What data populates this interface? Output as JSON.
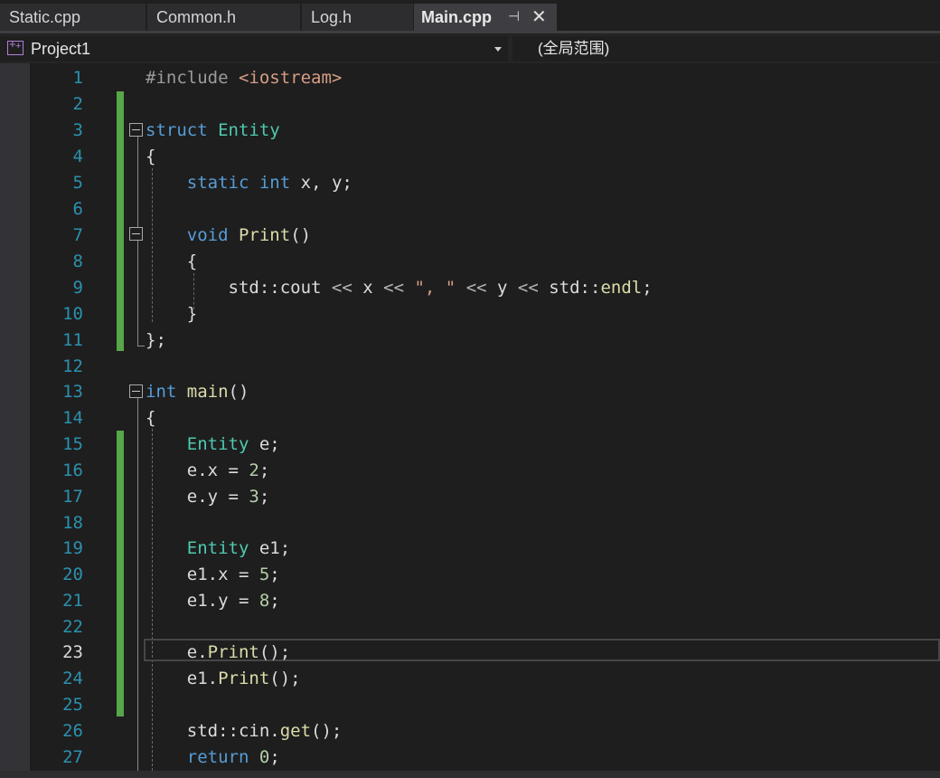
{
  "tabs": [
    {
      "label": "Static.cpp",
      "active": false
    },
    {
      "label": "Common.h",
      "active": false
    },
    {
      "label": "Log.h",
      "active": false
    },
    {
      "label": "Main.cpp",
      "active": true
    }
  ],
  "tab_icons": {
    "pin": "pin-icon",
    "close": "close-icon"
  },
  "nav": {
    "project": "Project1",
    "scope": "(全局范围)"
  },
  "editor": {
    "current_line": 23,
    "modified_line_ranges": [
      [
        2,
        11
      ],
      [
        15,
        25
      ]
    ],
    "lines": [
      {
        "n": "1",
        "code": "#include <iostream>"
      },
      {
        "n": "2",
        "code": ""
      },
      {
        "n": "3",
        "code": "struct Entity"
      },
      {
        "n": "4",
        "code": "{"
      },
      {
        "n": "5",
        "code": "    static int x, y;"
      },
      {
        "n": "6",
        "code": ""
      },
      {
        "n": "7",
        "code": "    void Print()"
      },
      {
        "n": "8",
        "code": "    {"
      },
      {
        "n": "9",
        "code": "        std::cout << x << \", \" << y << std::endl;"
      },
      {
        "n": "10",
        "code": "    }"
      },
      {
        "n": "11",
        "code": "};"
      },
      {
        "n": "12",
        "code": ""
      },
      {
        "n": "13",
        "code": "int main()"
      },
      {
        "n": "14",
        "code": "{"
      },
      {
        "n": "15",
        "code": "    Entity e;"
      },
      {
        "n": "16",
        "code": "    e.x = 2;"
      },
      {
        "n": "17",
        "code": "    e.y = 3;"
      },
      {
        "n": "18",
        "code": ""
      },
      {
        "n": "19",
        "code": "    Entity e1;"
      },
      {
        "n": "20",
        "code": "    e1.x = 5;"
      },
      {
        "n": "21",
        "code": "    e1.y = 8;"
      },
      {
        "n": "22",
        "code": ""
      },
      {
        "n": "23",
        "code": "    e.Print();"
      },
      {
        "n": "24",
        "code": "    e1.Print();"
      },
      {
        "n": "25",
        "code": ""
      },
      {
        "n": "26",
        "code": "    std::cin.get();"
      },
      {
        "n": "27",
        "code": "    return 0;"
      }
    ]
  },
  "colors": {
    "keyword": "#569cd6",
    "type": "#4ec9b0",
    "function": "#dcdcaa",
    "string": "#d69d85",
    "number": "#b5cea8",
    "preprocessor": "#9b9b9b",
    "line_number": "#2b91af",
    "modified_bar": "#57a64a",
    "background": "#1e1e1e"
  }
}
